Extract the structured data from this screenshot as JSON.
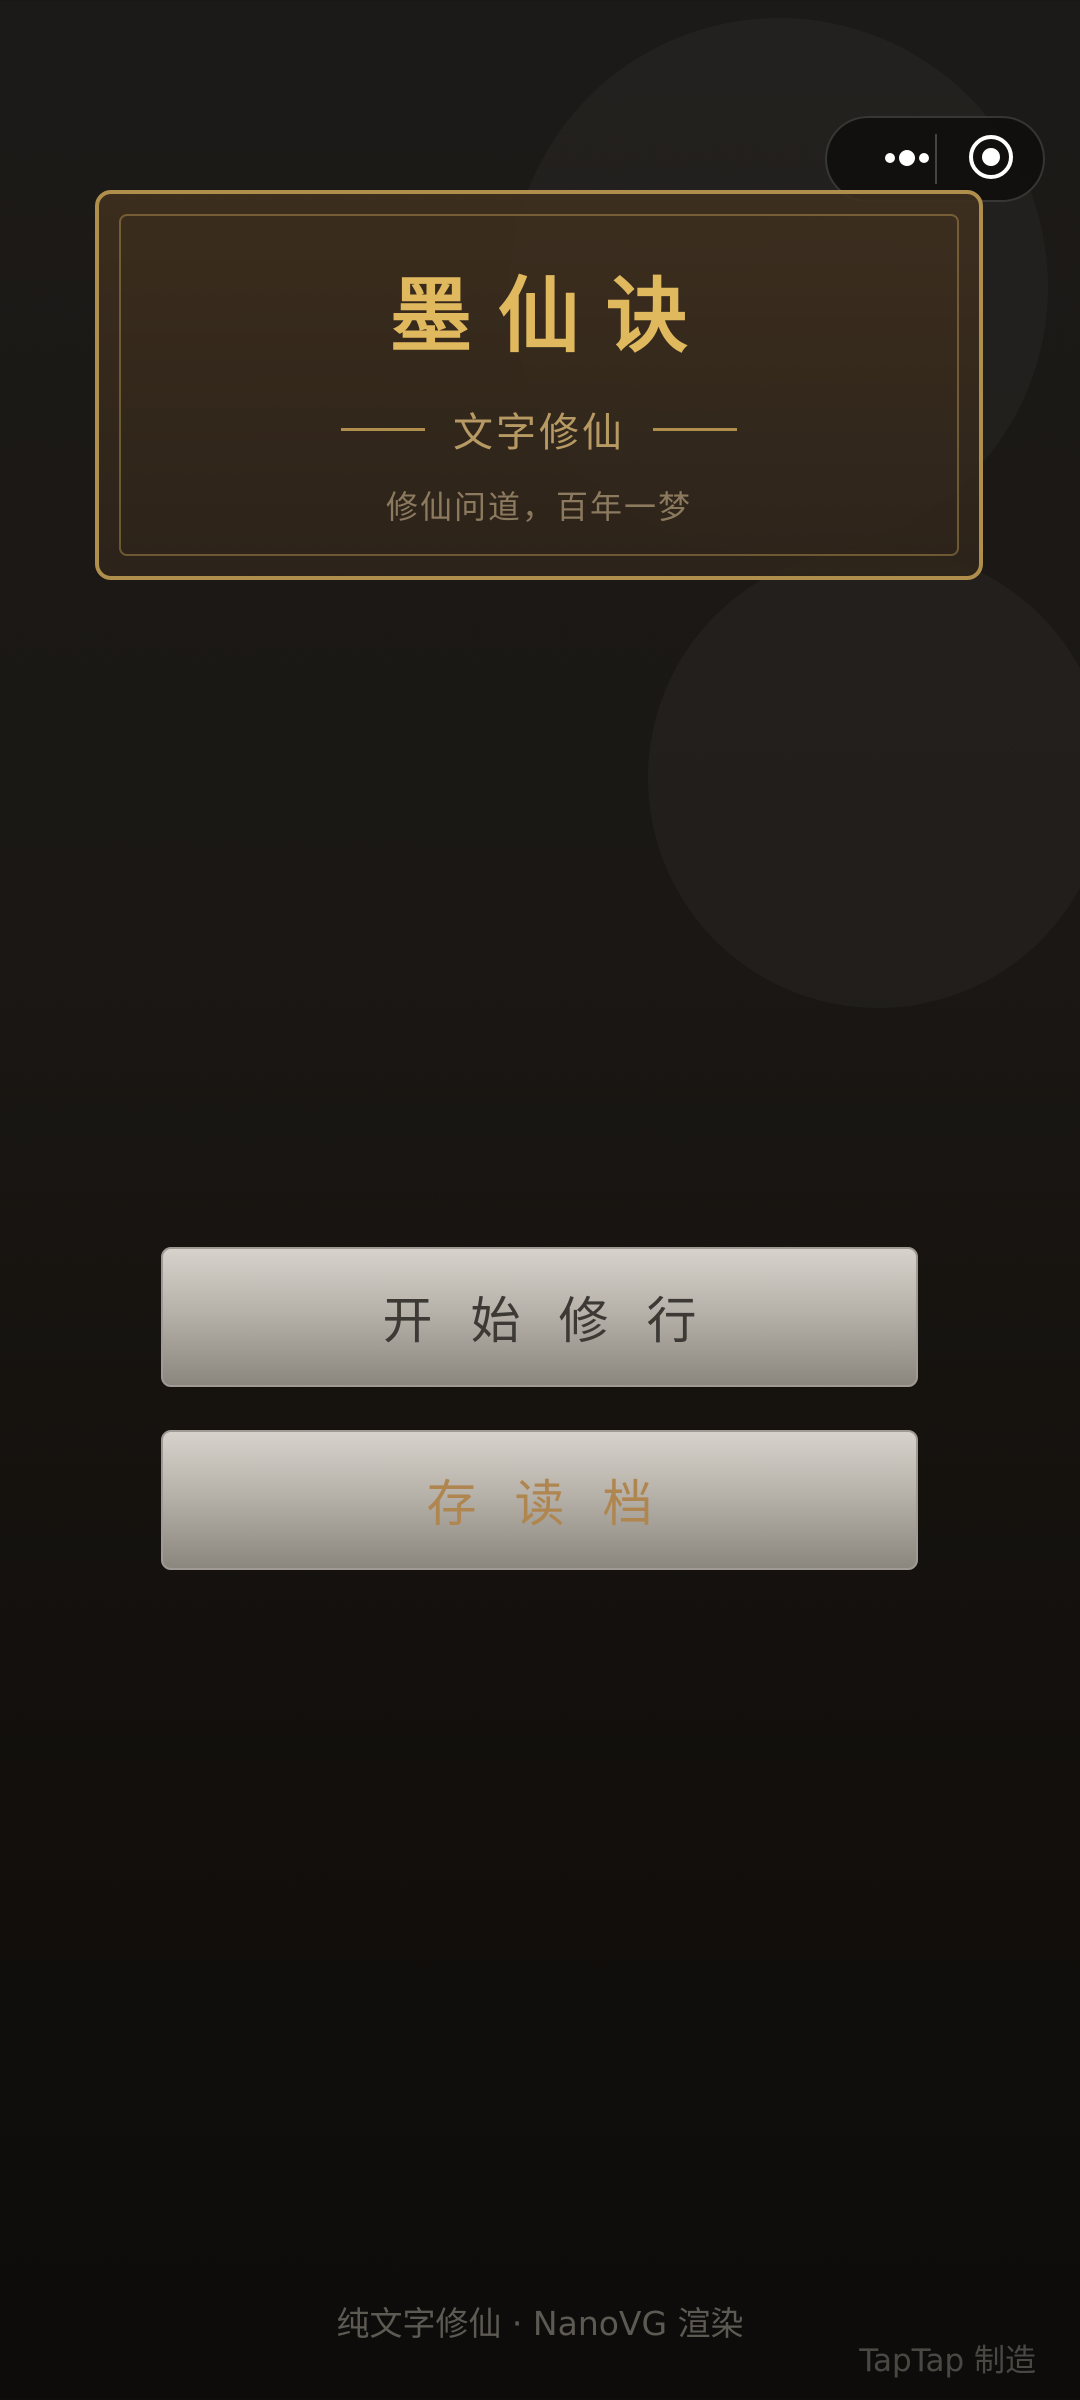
{
  "title_card": {
    "title": "墨仙诀",
    "subtitle": "文字修仙",
    "tagline": "修仙问道，百年一梦"
  },
  "menu": {
    "start_label": "开始修行",
    "save_label": "存读档"
  },
  "footer": {
    "info": "纯文字修仙 · NanoVG 渲染",
    "maker": "TapTap 制造"
  },
  "capsule": {
    "more_icon": "more-dots-icon",
    "close_icon": "target-circle-icon"
  },
  "colors": {
    "gold": "#e0b85e",
    "frame": "#b08e4c",
    "background": "#1a1714"
  }
}
